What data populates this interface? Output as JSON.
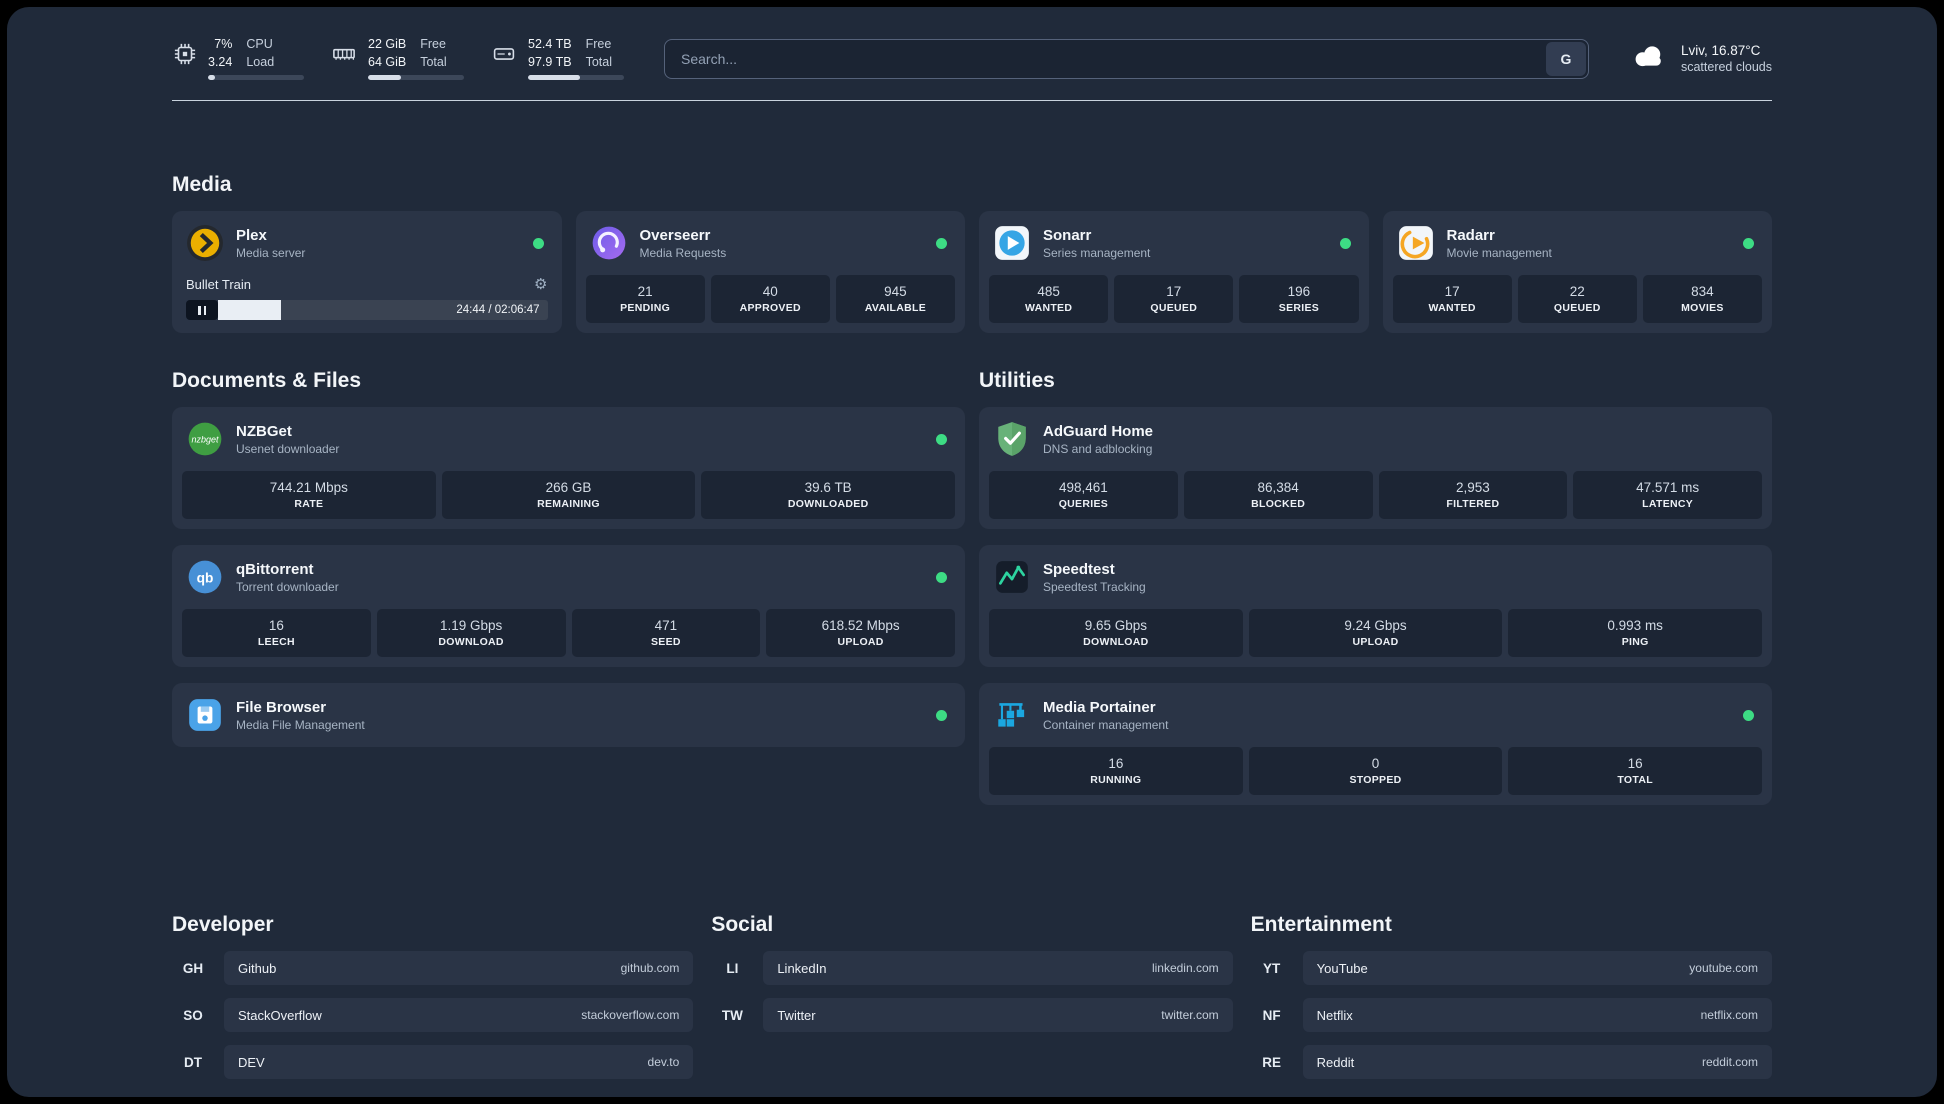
{
  "colors": {
    "status_online": "#3DDC84",
    "page_bg": "#202A3A",
    "card_bg": "#2A3446"
  },
  "header": {
    "cpu": {
      "value1": "7%",
      "value2": "3.24",
      "label1": "CPU",
      "label2": "Load",
      "bar_pct": 7
    },
    "memory": {
      "value1": "22 GiB",
      "value2": "64 GiB",
      "label1": "Free",
      "label2": "Total",
      "bar_pct": 34
    },
    "disk": {
      "value1": "52.4 TB",
      "value2": "97.9 TB",
      "label1": "Free",
      "label2": "Total",
      "bar_pct": 54
    },
    "search": {
      "placeholder": "Search...",
      "button": "G"
    },
    "weather": {
      "location": "Lviv, 16.87°C",
      "condition": "scattered clouds"
    }
  },
  "sections": {
    "media": {
      "title": "Media",
      "apps": [
        {
          "name": "Plex",
          "subtitle": "Media server",
          "icon": "plex-icon",
          "online": true,
          "player": {
            "title": "Bullet Train",
            "time": "24:44 / 02:06:47",
            "progress_pct": 19
          }
        },
        {
          "name": "Overseerr",
          "subtitle": "Media Requests",
          "icon": "overseerr-icon",
          "online": true,
          "stats": [
            {
              "value": "21",
              "label": "PENDING"
            },
            {
              "value": "40",
              "label": "APPROVED"
            },
            {
              "value": "945",
              "label": "AVAILABLE"
            }
          ]
        },
        {
          "name": "Sonarr",
          "subtitle": "Series management",
          "icon": "sonarr-icon",
          "online": true,
          "stats": [
            {
              "value": "485",
              "label": "WANTED"
            },
            {
              "value": "17",
              "label": "QUEUED"
            },
            {
              "value": "196",
              "label": "SERIES"
            }
          ]
        },
        {
          "name": "Radarr",
          "subtitle": "Movie management",
          "icon": "radarr-icon",
          "online": true,
          "stats": [
            {
              "value": "17",
              "label": "WANTED"
            },
            {
              "value": "22",
              "label": "QUEUED"
            },
            {
              "value": "834",
              "label": "MOVIES"
            }
          ]
        }
      ]
    },
    "documents": {
      "title": "Documents & Files",
      "apps": [
        {
          "name": "NZBGet",
          "subtitle": "Usenet downloader",
          "icon": "nzbget-icon",
          "online": true,
          "stats": [
            {
              "value": "744.21 Mbps",
              "label": "RATE"
            },
            {
              "value": "266 GB",
              "label": "REMAINING"
            },
            {
              "value": "39.6 TB",
              "label": "DOWNLOADED"
            }
          ]
        },
        {
          "name": "qBittorrent",
          "subtitle": "Torrent downloader",
          "icon": "qbittorrent-icon",
          "online": true,
          "stats": [
            {
              "value": "16",
              "label": "LEECH"
            },
            {
              "value": "1.19 Gbps",
              "label": "DOWNLOAD"
            },
            {
              "value": "471",
              "label": "SEED"
            },
            {
              "value": "618.52 Mbps",
              "label": "UPLOAD"
            }
          ]
        },
        {
          "name": "File Browser",
          "subtitle": "Media File Management",
          "icon": "filebrowser-icon",
          "online": true,
          "stats": []
        }
      ]
    },
    "utilities": {
      "title": "Utilities",
      "apps": [
        {
          "name": "AdGuard Home",
          "subtitle": "DNS and adblocking",
          "icon": "adguard-icon",
          "online": false,
          "stats": [
            {
              "value": "498,461",
              "label": "QUERIES"
            },
            {
              "value": "86,384",
              "label": "BLOCKED"
            },
            {
              "value": "2,953",
              "label": "FILTERED"
            },
            {
              "value": "47.571 ms",
              "label": "LATENCY"
            }
          ]
        },
        {
          "name": "Speedtest",
          "subtitle": "Speedtest Tracking",
          "icon": "speedtest-icon",
          "online": false,
          "stats": [
            {
              "value": "9.65 Gbps",
              "label": "DOWNLOAD"
            },
            {
              "value": "9.24 Gbps",
              "label": "UPLOAD"
            },
            {
              "value": "0.993 ms",
              "label": "PING"
            }
          ]
        },
        {
          "name": "Media Portainer",
          "subtitle": "Container management",
          "icon": "portainer-icon",
          "online": true,
          "stats": [
            {
              "value": "16",
              "label": "RUNNING"
            },
            {
              "value": "0",
              "label": "STOPPED"
            },
            {
              "value": "16",
              "label": "TOTAL"
            }
          ]
        }
      ]
    },
    "developer": {
      "title": "Developer",
      "bookmarks": [
        {
          "abbr": "GH",
          "name": "Github",
          "url": "github.com"
        },
        {
          "abbr": "SO",
          "name": "StackOverflow",
          "url": "stackoverflow.com"
        },
        {
          "abbr": "DT",
          "name": "DEV",
          "url": "dev.to"
        }
      ]
    },
    "social": {
      "title": "Social",
      "bookmarks": [
        {
          "abbr": "LI",
          "name": "LinkedIn",
          "url": "linkedin.com"
        },
        {
          "abbr": "TW",
          "name": "Twitter",
          "url": "twitter.com"
        }
      ]
    },
    "entertainment": {
      "title": "Entertainment",
      "bookmarks": [
        {
          "abbr": "YT",
          "name": "YouTube",
          "url": "youtube.com"
        },
        {
          "abbr": "NF",
          "name": "Netflix",
          "url": "netflix.com"
        },
        {
          "abbr": "RE",
          "name": "Reddit",
          "url": "reddit.com"
        }
      ]
    }
  }
}
